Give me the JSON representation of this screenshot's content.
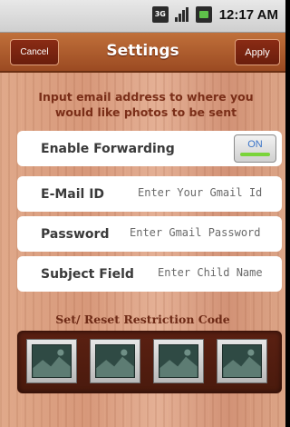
{
  "status_bar": {
    "time": "12:17 AM",
    "icons": [
      "network-3g-icon",
      "signal-icon",
      "battery-icon"
    ]
  },
  "title_bar": {
    "title": "Settings",
    "cancel_label": "Cancel",
    "apply_label": "Apply"
  },
  "form": {
    "intro": "Input email address to where you would like photos to be sent",
    "forwarding": {
      "label": "Enable Forwarding",
      "toggle_label": "ON",
      "enabled": true
    },
    "email": {
      "label": "E-Mail ID",
      "placeholder": "Enter Your Gmail Id",
      "value": ""
    },
    "password": {
      "label": "Password",
      "placeholder": "Enter Gmail Password",
      "value": ""
    },
    "subject": {
      "label": "Subject Field",
      "placeholder": "Enter Child Name",
      "value": ""
    }
  },
  "restriction": {
    "title": "Set/ Reset Restriction Code",
    "slots": [
      {
        "icon": "image-placeholder-icon"
      },
      {
        "icon": "image-placeholder-icon"
      },
      {
        "icon": "image-placeholder-icon"
      },
      {
        "icon": "image-placeholder-icon"
      }
    ]
  },
  "colors": {
    "title_bar": "#9b4a22",
    "accent_text": "#7a2e18",
    "toggle_on": "#7ad43a"
  }
}
